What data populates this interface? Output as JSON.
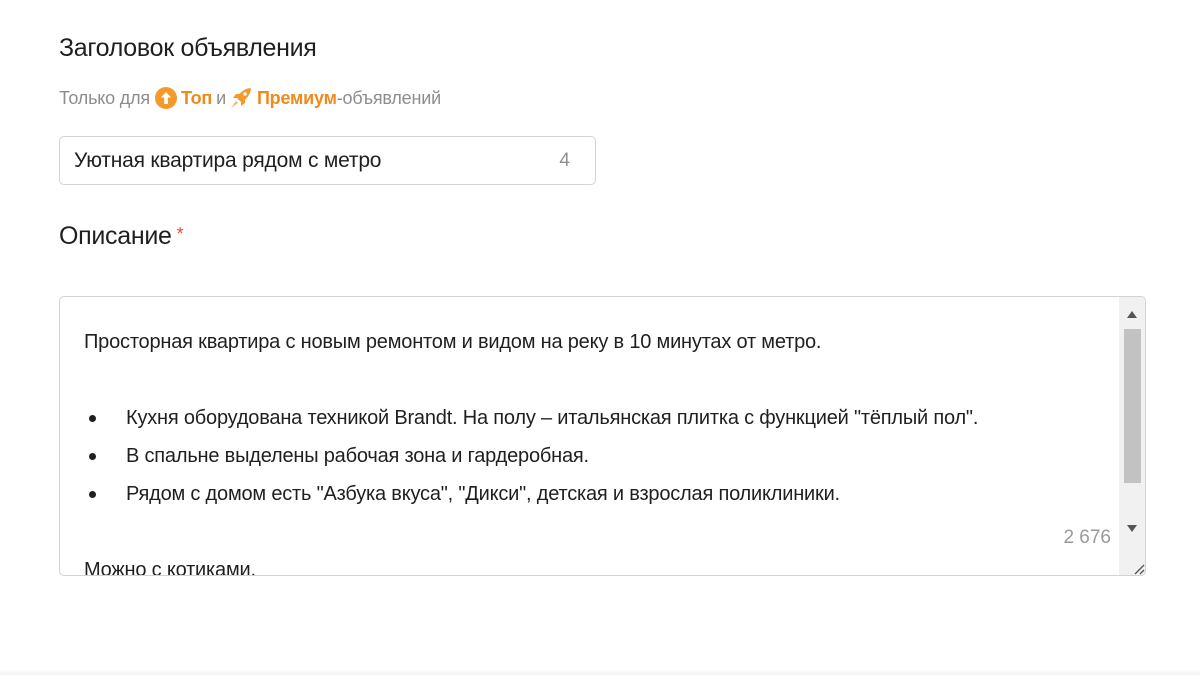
{
  "title_section": {
    "heading": "Заголовок объявления",
    "hint_prefix": "Только для",
    "hint_top": "Топ",
    "hint_and": "и",
    "hint_premium": "Премиум",
    "hint_suffix": "-объявлений",
    "input_value": "Уютная квартира рядом с метро",
    "counter": "4"
  },
  "description_section": {
    "heading": "Описание",
    "required_mark": "*",
    "intro": "Просторная квартира с новым ремонтом и видом на реку в 10 минутах от метро.",
    "bullets": [
      "Кухня оборудована техникой Brandt. На полу – итальянская плитка с функцией \"тёплый пол\".",
      "В спальне выделены рабочая зона и гардеробная.",
      "Рядом с домом есть \"Азбука вкуса\", \"Дикси\", детская и взрослая поликлиники."
    ],
    "closing": "Можно с котиками.",
    "counter": "2 676"
  },
  "colors": {
    "accent_orange": "#f08a1c",
    "required_red": "#e64a3a",
    "border": "#d3d3d3"
  },
  "icons": {
    "top_badge": "arrow-up-circle-icon",
    "premium_badge": "rocket-icon"
  }
}
